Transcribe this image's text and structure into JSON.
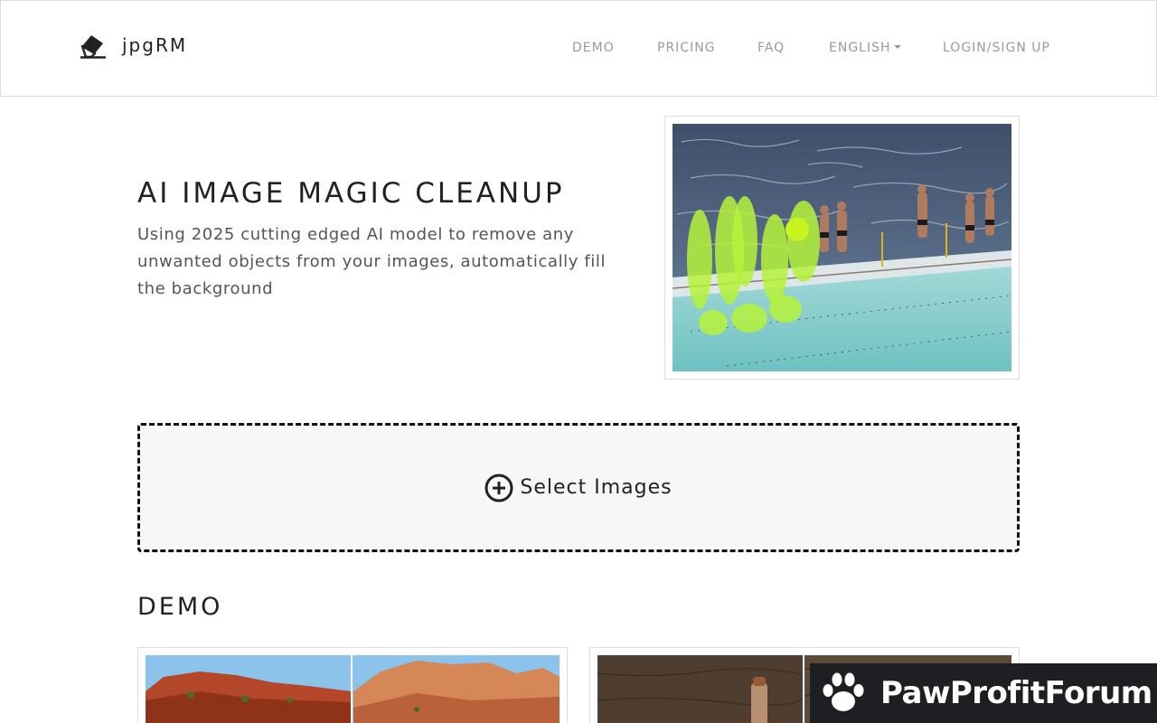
{
  "brand": {
    "name": "jpgRM",
    "icon": "eraser-icon"
  },
  "nav": {
    "items": [
      "DEMO",
      "PRICING",
      "FAQ",
      "ENGLISH",
      "LOGIN/SIGN UP"
    ]
  },
  "hero": {
    "title": "AI IMAGE MAGIC CLEANUP",
    "subtitle": "Using 2025 cutting edged AI model to remove any unwanted objects from your images, automatically fill the background",
    "image": "swimmers-pool-mask-image"
  },
  "upload": {
    "icon": "plus-circle-icon",
    "label": "Select Images"
  },
  "demo": {
    "heading": "DEMO",
    "cards": [
      "canyon-before-after-image",
      "wood-bottle-before-after-image"
    ]
  },
  "watermark": {
    "icon": "paw-icon",
    "text": "PawProfitForum"
  },
  "colors": {
    "mask": "#b6f23a",
    "border": "#dcdcdc",
    "nav_text": "#9a9a9a"
  }
}
